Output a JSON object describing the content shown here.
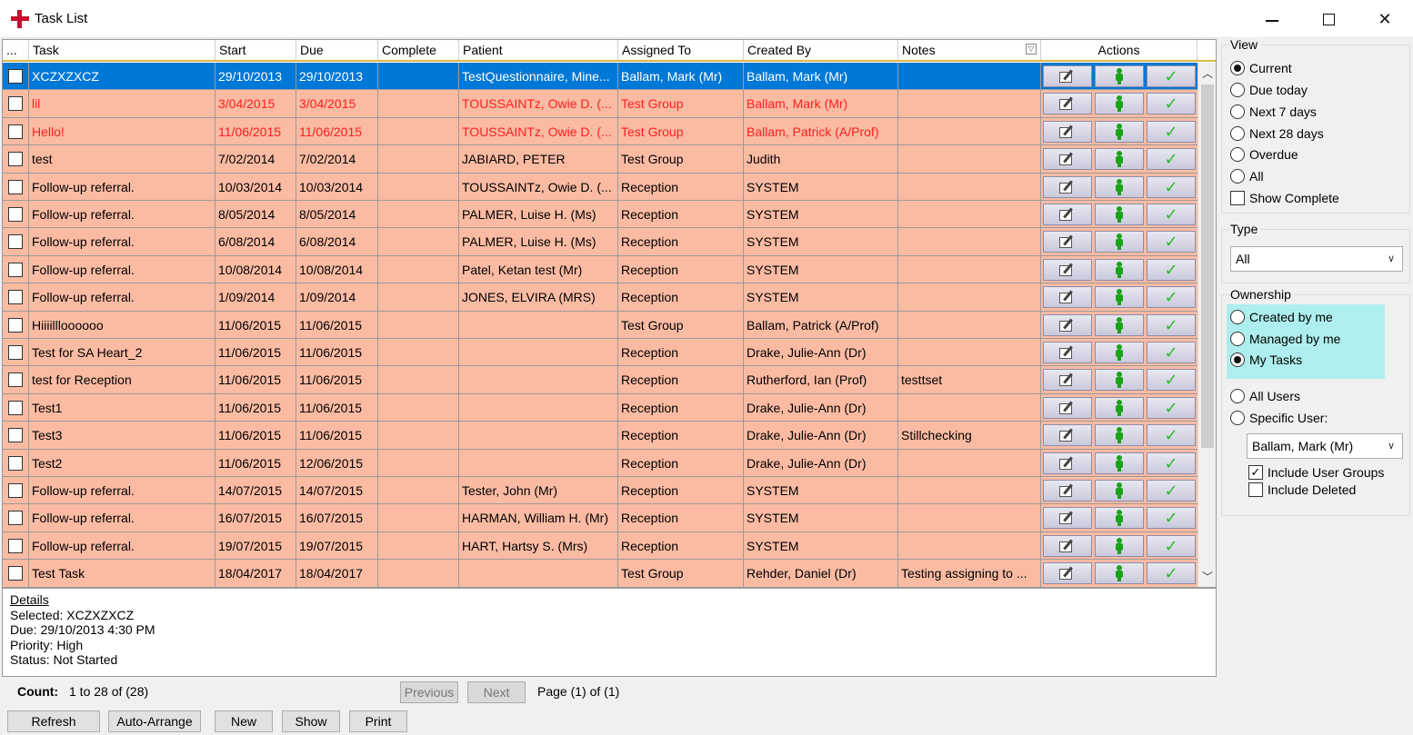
{
  "window": {
    "title": "Task List"
  },
  "grid": {
    "headers": {
      "select": "...",
      "task": "Task",
      "start": "Start",
      "due": "Due",
      "complete": "Complete",
      "patient": "Patient",
      "assigned": "Assigned To",
      "created": "Created By",
      "notes": "Notes",
      "actions": "Actions"
    },
    "rows": [
      {
        "task": "XCZXZXCZ",
        "start": "29/10/2013",
        "due": "29/10/2013",
        "complete": "",
        "patient": "TestQuestionnaire, Mine...",
        "assigned": "Ballam, Mark (Mr)",
        "created": "Ballam, Mark (Mr)",
        "notes": "",
        "style": "selected"
      },
      {
        "task": "lil",
        "start": "3/04/2015",
        "due": "3/04/2015",
        "complete": "",
        "patient": "TOUSSAINTz, Owie D. (...",
        "assigned": "Test Group",
        "created": "Ballam, Mark (Mr)",
        "notes": "",
        "style": "red"
      },
      {
        "task": "Hello!",
        "start": "11/06/2015",
        "due": "11/06/2015",
        "complete": "",
        "patient": "TOUSSAINTz, Owie D. (...",
        "assigned": "Test Group",
        "created": "Ballam, Patrick (A/Prof)",
        "notes": "",
        "style": "red"
      },
      {
        "task": "test",
        "start": "7/02/2014",
        "due": "7/02/2014",
        "complete": "",
        "patient": "JABIARD, PETER",
        "assigned": "Test Group",
        "created": "Judith",
        "notes": "",
        "style": ""
      },
      {
        "task": "Follow-up referral.",
        "start": "10/03/2014",
        "due": "10/03/2014",
        "complete": "",
        "patient": "TOUSSAINTz, Owie D. (...",
        "assigned": "Reception",
        "created": "SYSTEM",
        "notes": "",
        "style": ""
      },
      {
        "task": "Follow-up referral.",
        "start": "8/05/2014",
        "due": "8/05/2014",
        "complete": "",
        "patient": "PALMER, Luise H. (Ms)",
        "assigned": "Reception",
        "created": "SYSTEM",
        "notes": "",
        "style": ""
      },
      {
        "task": "Follow-up referral.",
        "start": "6/08/2014",
        "due": "6/08/2014",
        "complete": "",
        "patient": "PALMER, Luise H. (Ms)",
        "assigned": "Reception",
        "created": "SYSTEM",
        "notes": "",
        "style": ""
      },
      {
        "task": "Follow-up referral.",
        "start": "10/08/2014",
        "due": "10/08/2014",
        "complete": "",
        "patient": "Patel, Ketan test (Mr)",
        "assigned": "Reception",
        "created": "SYSTEM",
        "notes": "",
        "style": ""
      },
      {
        "task": "Follow-up referral.",
        "start": "1/09/2014",
        "due": "1/09/2014",
        "complete": "",
        "patient": "JONES, ELVIRA (MRS)",
        "assigned": "Reception",
        "created": "SYSTEM",
        "notes": "",
        "style": ""
      },
      {
        "task": "Hiiiillloooooo",
        "start": "11/06/2015",
        "due": "11/06/2015",
        "complete": "",
        "patient": "",
        "assigned": "Test Group",
        "created": "Ballam, Patrick (A/Prof)",
        "notes": "",
        "style": ""
      },
      {
        "task": "Test for SA Heart_2",
        "start": "11/06/2015",
        "due": "11/06/2015",
        "complete": "",
        "patient": "",
        "assigned": "Reception",
        "created": "Drake, Julie-Ann (Dr)",
        "notes": "",
        "style": ""
      },
      {
        "task": "test for Reception",
        "start": "11/06/2015",
        "due": "11/06/2015",
        "complete": "",
        "patient": "",
        "assigned": "Reception",
        "created": "Rutherford, Ian (Prof)",
        "notes": "testtset",
        "style": ""
      },
      {
        "task": "Test1",
        "start": "11/06/2015",
        "due": "11/06/2015",
        "complete": "",
        "patient": "",
        "assigned": "Reception",
        "created": "Drake, Julie-Ann (Dr)",
        "notes": "",
        "style": ""
      },
      {
        "task": "Test3",
        "start": "11/06/2015",
        "due": "11/06/2015",
        "complete": "",
        "patient": "",
        "assigned": "Reception",
        "created": "Drake, Julie-Ann (Dr)",
        "notes": "Stillchecking",
        "style": ""
      },
      {
        "task": "Test2",
        "start": "11/06/2015",
        "due": "12/06/2015",
        "complete": "",
        "patient": "",
        "assigned": "Reception",
        "created": "Drake, Julie-Ann (Dr)",
        "notes": "",
        "style": ""
      },
      {
        "task": "Follow-up referral.",
        "start": "14/07/2015",
        "due": "14/07/2015",
        "complete": "",
        "patient": "Tester, John (Mr)",
        "assigned": "Reception",
        "created": "SYSTEM",
        "notes": "",
        "style": ""
      },
      {
        "task": "Follow-up referral.",
        "start": "16/07/2015",
        "due": "16/07/2015",
        "complete": "",
        "patient": "HARMAN, William H. (Mr)",
        "assigned": "Reception",
        "created": "SYSTEM",
        "notes": "",
        "style": ""
      },
      {
        "task": "Follow-up referral.",
        "start": "19/07/2015",
        "due": "19/07/2015",
        "complete": "",
        "patient": "HART, Hartsy S. (Mrs)",
        "assigned": "Reception",
        "created": "SYSTEM",
        "notes": "",
        "style": ""
      },
      {
        "task": "Test Task",
        "start": "18/04/2017",
        "due": "18/04/2017",
        "complete": "",
        "patient": "",
        "assigned": "Test Group",
        "created": "Rehder, Daniel (Dr)",
        "notes": "Testing assigning to ...",
        "style": ""
      }
    ]
  },
  "details": {
    "title": "Details",
    "selected": "Selected: XCZXZXCZ",
    "due": "Due: 29/10/2013 4:30 PM",
    "priority": "Priority: High",
    "status": "Status: Not Started"
  },
  "footer": {
    "count_label": "Count:",
    "count_value": "1 to 28 of (28)",
    "previous": "Previous",
    "next": "Next",
    "page_info": "Page (1) of (1)",
    "buttons": {
      "refresh": "Refresh",
      "auto_arrange": "Auto-Arrange",
      "new": "New",
      "show": "Show",
      "print": "Print"
    }
  },
  "panel": {
    "view": {
      "label": "View",
      "options": [
        "Current",
        "Due today",
        "Next 7 days",
        "Next 28 days",
        "Overdue",
        "All"
      ],
      "selected": "Current",
      "show_complete": "Show Complete"
    },
    "type": {
      "label": "Type",
      "value": "All"
    },
    "ownership": {
      "label": "Ownership",
      "options": [
        "Created by me",
        "Managed by me",
        "My Tasks"
      ],
      "selected": "My Tasks",
      "all_users": "All Users",
      "specific_user": "Specific User:",
      "user_value": "Ballam, Mark (Mr)",
      "include_groups": "Include User Groups",
      "include_deleted": "Include Deleted"
    }
  },
  "colors": {
    "row_bg": "#fbbba3",
    "selected_bg": "#0078d7",
    "red_text": "#ff1e1e",
    "ownership_highlight": "#aeeeee"
  }
}
